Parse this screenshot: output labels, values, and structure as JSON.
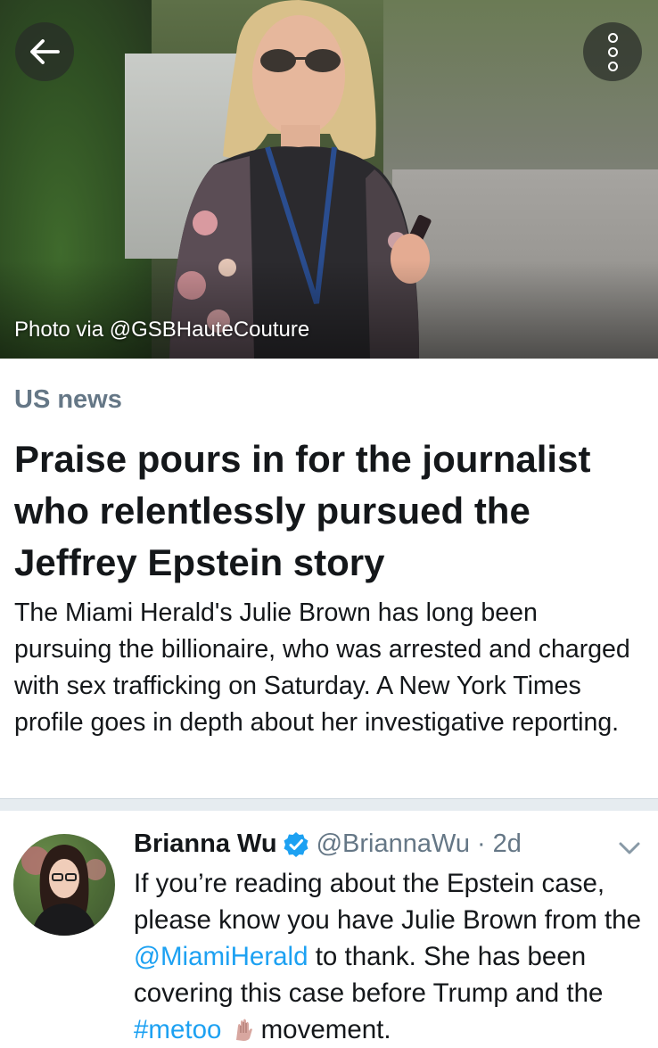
{
  "hero": {
    "photo_credit": "Photo via @GSBHauteCouture"
  },
  "toolbar": {
    "back_icon": "arrow-left-icon",
    "more_icon": "more-vertical-icon"
  },
  "article": {
    "category": "US news",
    "headline": "Praise pours in for the journalist who relentlessly pursued the Jeffrey Epstein story",
    "summary": "The Miami Herald's Julie Brown has long been pursuing the billionaire, who was arrested and charged with sex trafficking on Saturday. A New York Times profile goes in depth about her investigative reporting."
  },
  "tweet": {
    "name": "Brianna Wu",
    "handle": "@BriannaWu",
    "separator": "·",
    "time": "2d",
    "text_part1": "If you’re reading about the Epstein case, please know you have Julie Brown from the ",
    "mention": "@MiamiHerald",
    "text_part2": " to thank. She has been covering this case before Trump and the ",
    "hashtag": "#metoo",
    "text_part3": "movement."
  },
  "colors": {
    "link": "#1da1f2",
    "secondary_text": "#657786",
    "divider": "#e6ecf0"
  }
}
